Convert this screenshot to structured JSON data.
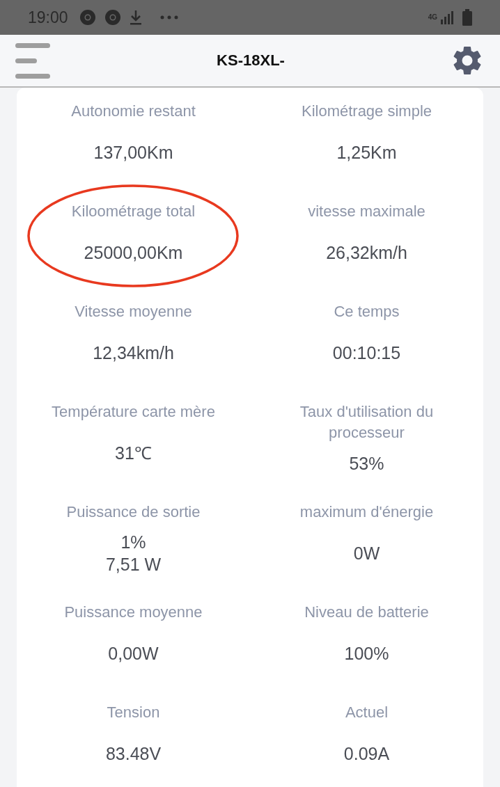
{
  "status_bar": {
    "time": "19:00",
    "network": "4G"
  },
  "header": {
    "title": "KS-18XL-"
  },
  "cells": [
    {
      "label": "Autonomie restant",
      "values": [
        "137,00Km"
      ]
    },
    {
      "label": "Kilométrage simple",
      "values": [
        "1,25Km"
      ]
    },
    {
      "label": "Kiloométrage total",
      "values": [
        "25000,00Km"
      ],
      "circled": true
    },
    {
      "label": "vitesse maximale",
      "values": [
        "26,32km/h"
      ]
    },
    {
      "label": "Vitesse moyenne",
      "values": [
        "12,34km/h"
      ]
    },
    {
      "label": "Ce temps",
      "values": [
        "00:10:15"
      ]
    },
    {
      "label": "Température carte mère",
      "values": [
        "31℃"
      ]
    },
    {
      "label": "Taux d'utilisation du processeur",
      "values": [
        "53%"
      ]
    },
    {
      "label": "Puissance de sortie",
      "values": [
        "1%",
        "7,51 W"
      ]
    },
    {
      "label": "maximum d'énergie",
      "values": [
        "0W"
      ]
    },
    {
      "label": "Puissance moyenne",
      "values": [
        "0,00W"
      ]
    },
    {
      "label": "Niveau de batterie",
      "values": [
        "100%"
      ]
    },
    {
      "label": "Tension",
      "values": [
        "83.48V"
      ]
    },
    {
      "label": "Actuel",
      "values": [
        "0.09A"
      ]
    }
  ]
}
